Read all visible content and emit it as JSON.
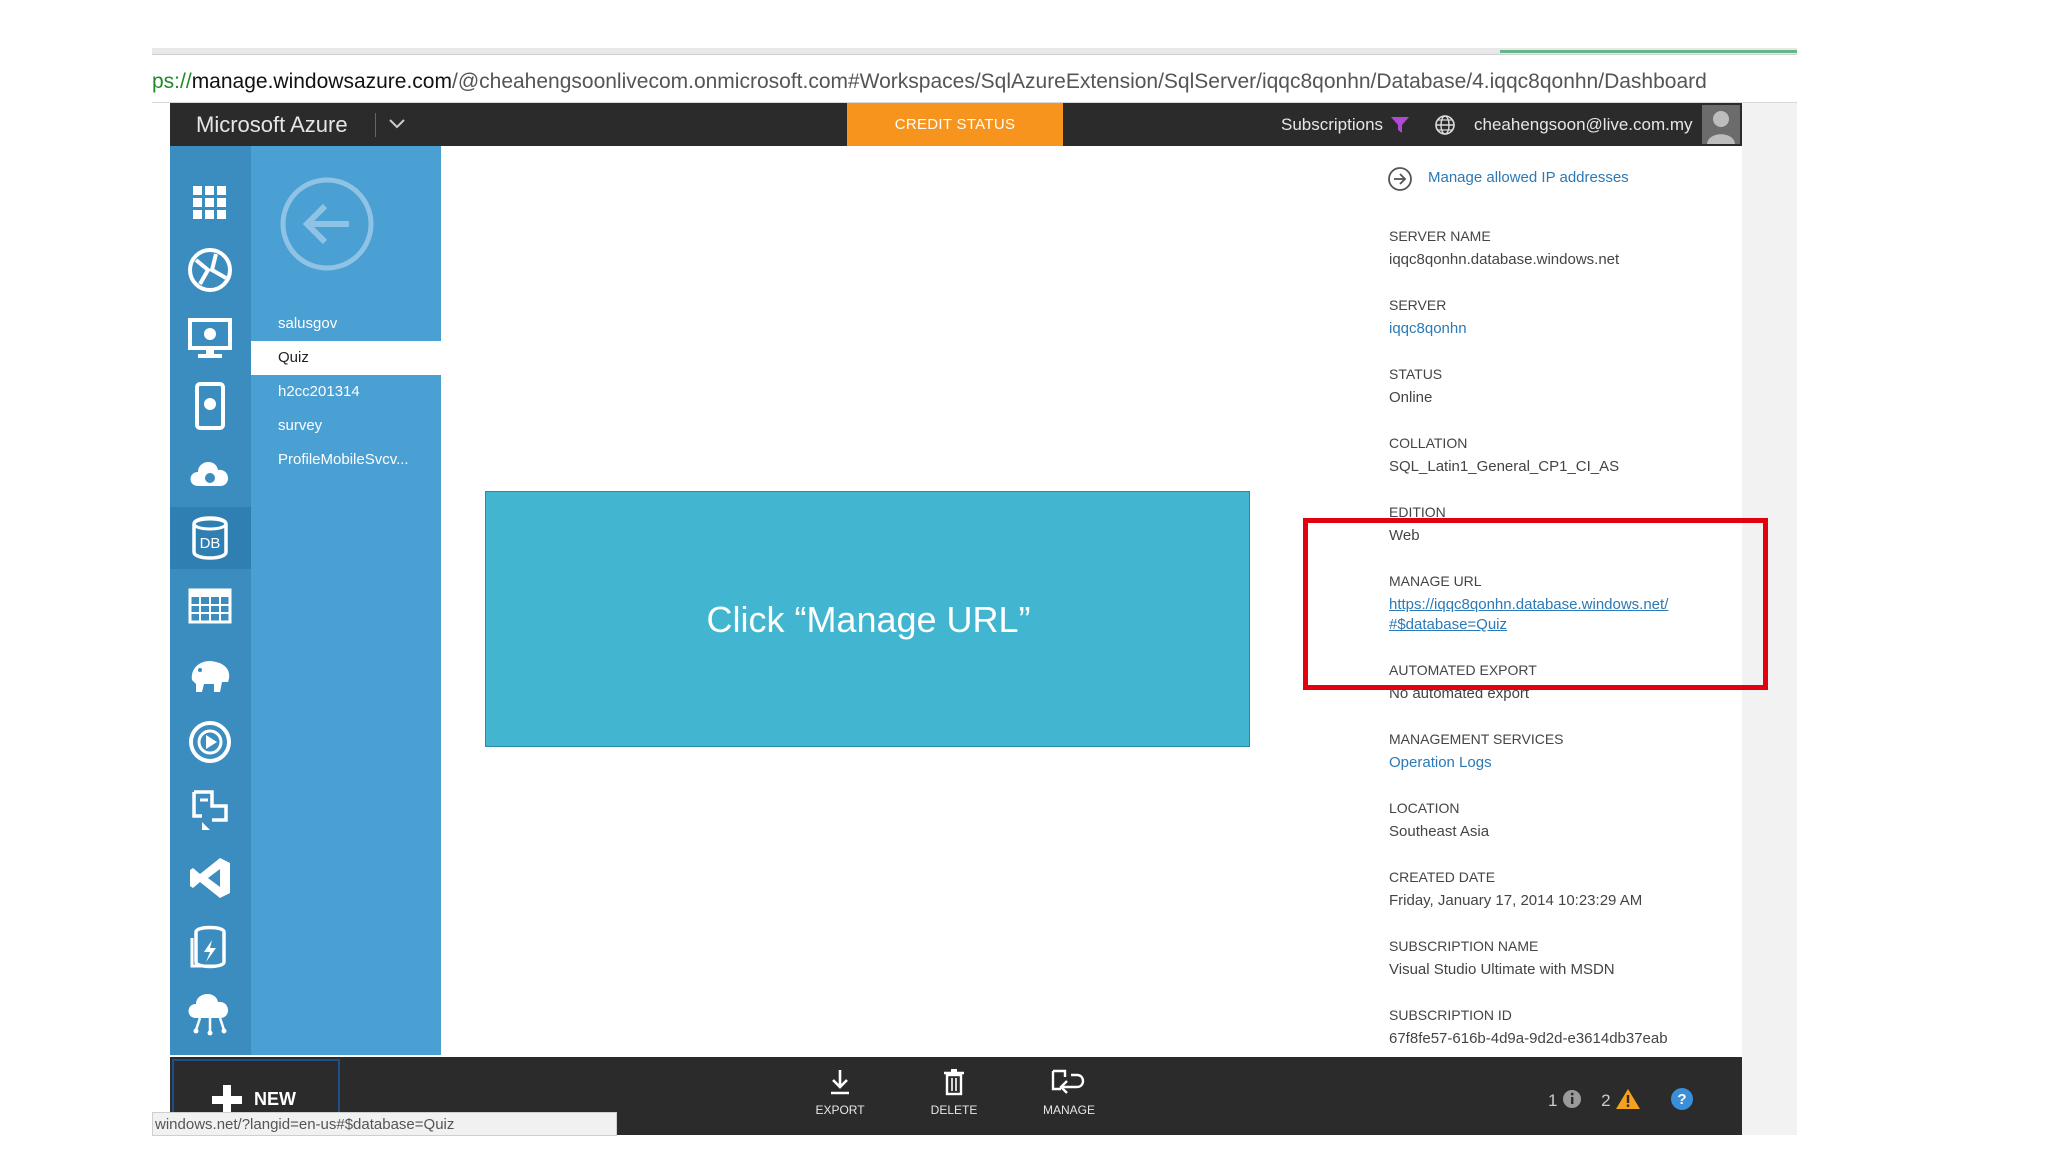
{
  "browser": {
    "url_scheme": "ps://",
    "url_host": "manage.windowsazure.com",
    "url_path": "/@cheahengsoonlivecom.onmicrosoft.com#Workspaces/SqlAzureExtension/SqlServer/iqqc8qonhn/Database/4.iqqc8qonhn/Dashboard",
    "status_url": "windows.net/?langid=en-us#$database=Quiz"
  },
  "header": {
    "brand": "Microsoft Azure",
    "credit_status": "CREDIT STATUS",
    "subscriptions": "Subscriptions",
    "email": "cheahengsoon@live.com.my"
  },
  "nav_icons": [
    "grid-icon",
    "web-sites-icon",
    "virtual-machines-icon",
    "mobile-services-icon",
    "cloud-services-icon",
    "sql-databases-icon",
    "storage-icon",
    "hdinsight-icon",
    "media-services-icon",
    "service-bus-icon",
    "visual-studio-icon",
    "cache-icon",
    "cloud-network-icon"
  ],
  "list": {
    "items": [
      {
        "label": "salusgov",
        "selected": false
      },
      {
        "label": "Quiz",
        "selected": true
      },
      {
        "label": "h2cc201314",
        "selected": false
      },
      {
        "label": "survey",
        "selected": false
      },
      {
        "label": "ProfileMobileSvcv...",
        "selected": false
      }
    ]
  },
  "callout": {
    "text": "Click  “Manage URL”"
  },
  "properties": {
    "manage_ip": "Manage allowed IP addresses",
    "server_name_label": "SERVER NAME",
    "server_name": "iqqc8qonhn.database.windows.net",
    "server_label": "SERVER",
    "server": "iqqc8qonhn",
    "status_label": "STATUS",
    "status": "Online",
    "collation_label": "COLLATION",
    "collation": "SQL_Latin1_General_CP1_CI_AS",
    "edition_label": "EDITION",
    "edition": "Web",
    "manage_url_label": "MANAGE URL",
    "manage_url_line1": "https://iqqc8qonhn.database.windows.net/",
    "manage_url_line2": "#$database=Quiz",
    "automated_export_label": "AUTOMATED EXPORT",
    "automated_export": "No automated export",
    "management_services_label": "MANAGEMENT SERVICES",
    "operation_logs": "Operation Logs",
    "location_label": "LOCATION",
    "location": "Southeast Asia",
    "created_date_label": "CREATED DATE",
    "created_date": "Friday, January 17, 2014 10:23:29 AM",
    "subscription_name_label": "SUBSCRIPTION NAME",
    "subscription_name": "Visual Studio Ultimate with MSDN",
    "subscription_id_label": "SUBSCRIPTION ID",
    "subscription_id": "67f8fe57-616b-4d9a-9d2d-e3614db37eab"
  },
  "bottombar": {
    "new_label": "NEW",
    "export_label": "EXPORT",
    "delete_label": "DELETE",
    "manage_label": "MANAGE",
    "info_count": "1",
    "warning_count": "2"
  },
  "colors": {
    "accent_orange": "#f7941d",
    "nav_blue": "#3b8cbf",
    "callout": "#42b6d1",
    "highlight_red": "#e3000f"
  }
}
